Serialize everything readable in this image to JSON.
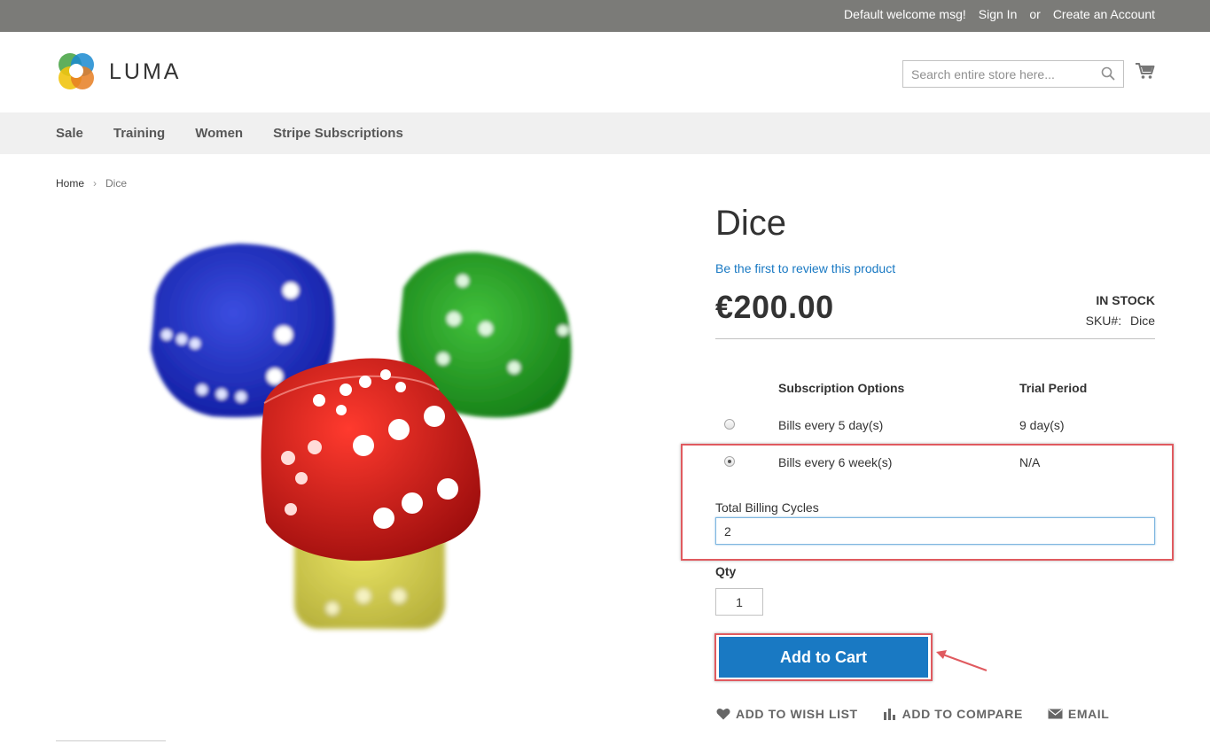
{
  "topbar": {
    "welcome": "Default welcome msg!",
    "sign_in": "Sign In",
    "or": "or",
    "create_account": "Create an Account"
  },
  "header": {
    "logo_text": "LUMA",
    "search_placeholder": "Search entire store here...",
    "icons": {
      "search": "search-icon",
      "cart": "cart-icon"
    }
  },
  "nav": {
    "items": [
      "Sale",
      "Training",
      "Women",
      "Stripe Subscriptions"
    ]
  },
  "breadcrumb": {
    "home": "Home",
    "separator": "›",
    "current": "Dice"
  },
  "product": {
    "title": "Dice",
    "review_link": "Be the first to review this product",
    "price": "€200.00",
    "stock": "IN STOCK",
    "sku_label": "SKU#:",
    "sku_value": "Dice",
    "image_alt": "dice image"
  },
  "subscription": {
    "headers": {
      "options": "Subscription Options",
      "trial": "Trial Period"
    },
    "rows": [
      {
        "label": "Bills every 5 day(s)",
        "trial": "9 day(s)",
        "selected": false
      },
      {
        "label": "Bills every 6 week(s)",
        "trial": "N/A",
        "selected": true
      }
    ],
    "billing_cycles_label": "Total Billing Cycles",
    "billing_cycles_value": "2"
  },
  "qty": {
    "label": "Qty",
    "value": "1"
  },
  "add_to_cart": "Add to Cart",
  "actions": {
    "wishlist": "Add to Wish List",
    "compare": "Add to Compare",
    "email": "Email"
  },
  "colors": {
    "topbar": "#7b7b78",
    "link": "#1979c3",
    "primary_button": "#1979c3",
    "highlight": "#e05a5f",
    "nav_bg": "#f0f0f0"
  }
}
